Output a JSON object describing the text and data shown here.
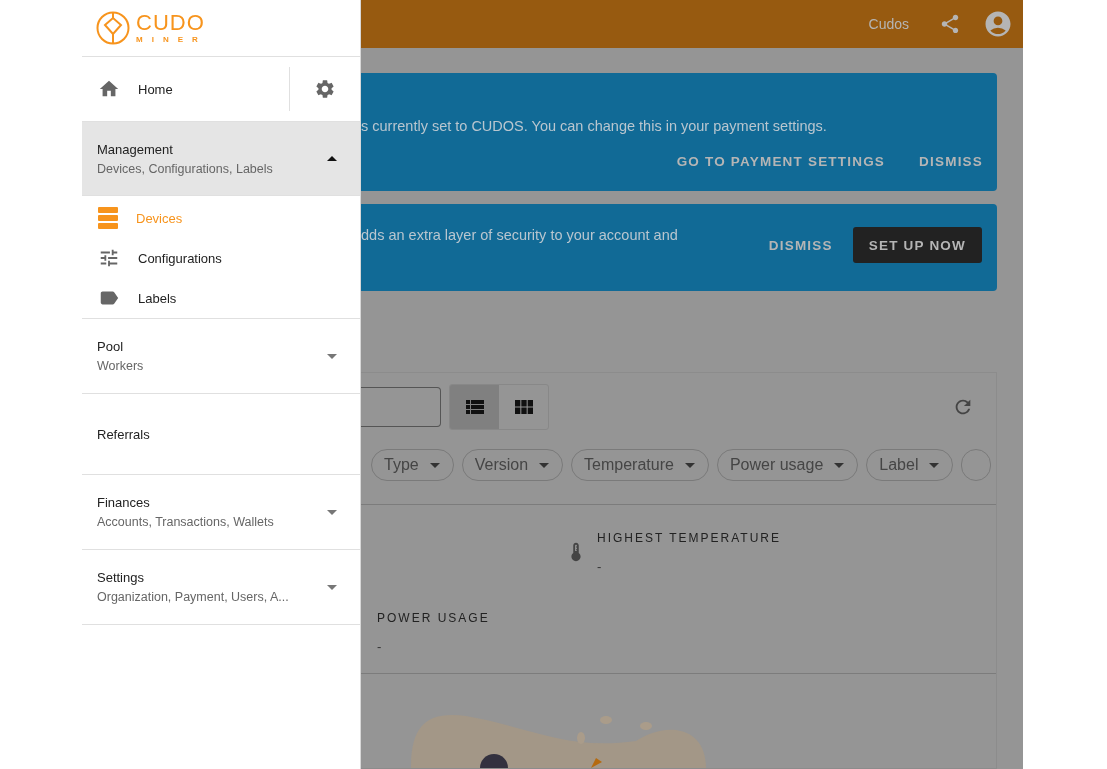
{
  "drawer": {
    "logo": {
      "word": "CUDO",
      "subword": "MINER"
    },
    "home": {
      "label": "Home",
      "selected": false
    },
    "sections": [
      {
        "title": "Management",
        "subtitle": "Devices, Configurations, Labels",
        "expanded": true,
        "selected": true,
        "children": [
          {
            "label": "Devices",
            "selected": true
          },
          {
            "label": "Configurations",
            "selected": false
          },
          {
            "label": "Labels",
            "selected": false
          }
        ]
      },
      {
        "title": "Pool",
        "subtitle": "Workers",
        "expanded": false,
        "selected": false
      },
      {
        "title": "Referrals",
        "selected": false
      },
      {
        "title": "Finances",
        "subtitle": "Accounts, Transactions, Wallets",
        "expanded": false,
        "selected": false
      },
      {
        "title": "Settings",
        "subtitle": "Organization, Payment, Users, A...",
        "expanded": false,
        "selected": false
      }
    ]
  },
  "topbar": {
    "organization": "Cudos"
  },
  "banners": [
    {
      "text": "s currently set to CUDOS. You can change this in your payment settings.",
      "actions": [
        {
          "label": "GO TO PAYMENT SETTINGS",
          "kind": "text"
        },
        {
          "label": "DISMISS",
          "kind": "text"
        }
      ]
    },
    {
      "text": "dds an extra layer of security to your account and",
      "actions": [
        {
          "label": "DISMISS",
          "kind": "text"
        },
        {
          "label": "SET UP NOW",
          "kind": "filled"
        }
      ]
    }
  ],
  "devices": {
    "view_modes": [
      {
        "kind": "list",
        "selected": true
      },
      {
        "kind": "grid",
        "selected": false
      }
    ],
    "filters": [
      "Type",
      "Version",
      "Temperature",
      "Power usage",
      "Label"
    ],
    "stats": [
      {
        "label": "HIGHEST TEMPERATURE",
        "value": "-"
      },
      {
        "label": "POWER USAGE",
        "value": "-"
      }
    ]
  }
}
